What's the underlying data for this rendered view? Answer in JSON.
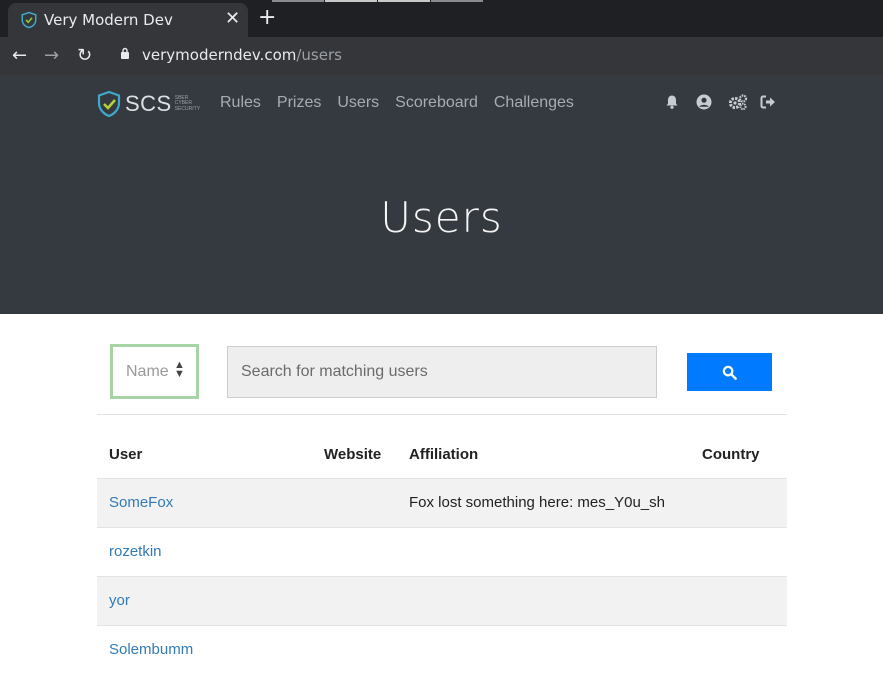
{
  "browser": {
    "tab_title": "Very Modern Dev",
    "tab_close": "✕",
    "new_tab": "+",
    "back": "←",
    "forward": "→",
    "reload": "↻",
    "url_host": "verymoderndev.com",
    "url_path": "/users"
  },
  "site": {
    "logo_text": "SCS",
    "logo_small": "SBER CYBER SECURITY",
    "nav": [
      "Rules",
      "Prizes",
      "Users",
      "Scoreboard",
      "Challenges"
    ],
    "icons": [
      "bell-icon",
      "user-circle-icon",
      "cogs-icon",
      "sign-out-icon"
    ],
    "page_title": "Users"
  },
  "search": {
    "field_label": "Name",
    "placeholder": "Search for matching users",
    "value": ""
  },
  "table": {
    "headers": [
      "User",
      "Website",
      "Affiliation",
      "Country"
    ],
    "rows": [
      {
        "user": "SomeFox",
        "website": "",
        "affiliation": "Fox lost something here: mes_Y0u_sh",
        "country": ""
      },
      {
        "user": "rozetkin",
        "website": "",
        "affiliation": "",
        "country": ""
      },
      {
        "user": "yor",
        "website": "",
        "affiliation": "",
        "country": ""
      },
      {
        "user": "Solembumm",
        "website": "",
        "affiliation": "",
        "country": ""
      }
    ]
  },
  "colors": {
    "header_bg": "#343a40",
    "button_primary": "#007bff",
    "link": "#337ab7",
    "select_border": "#a7d3a7"
  }
}
